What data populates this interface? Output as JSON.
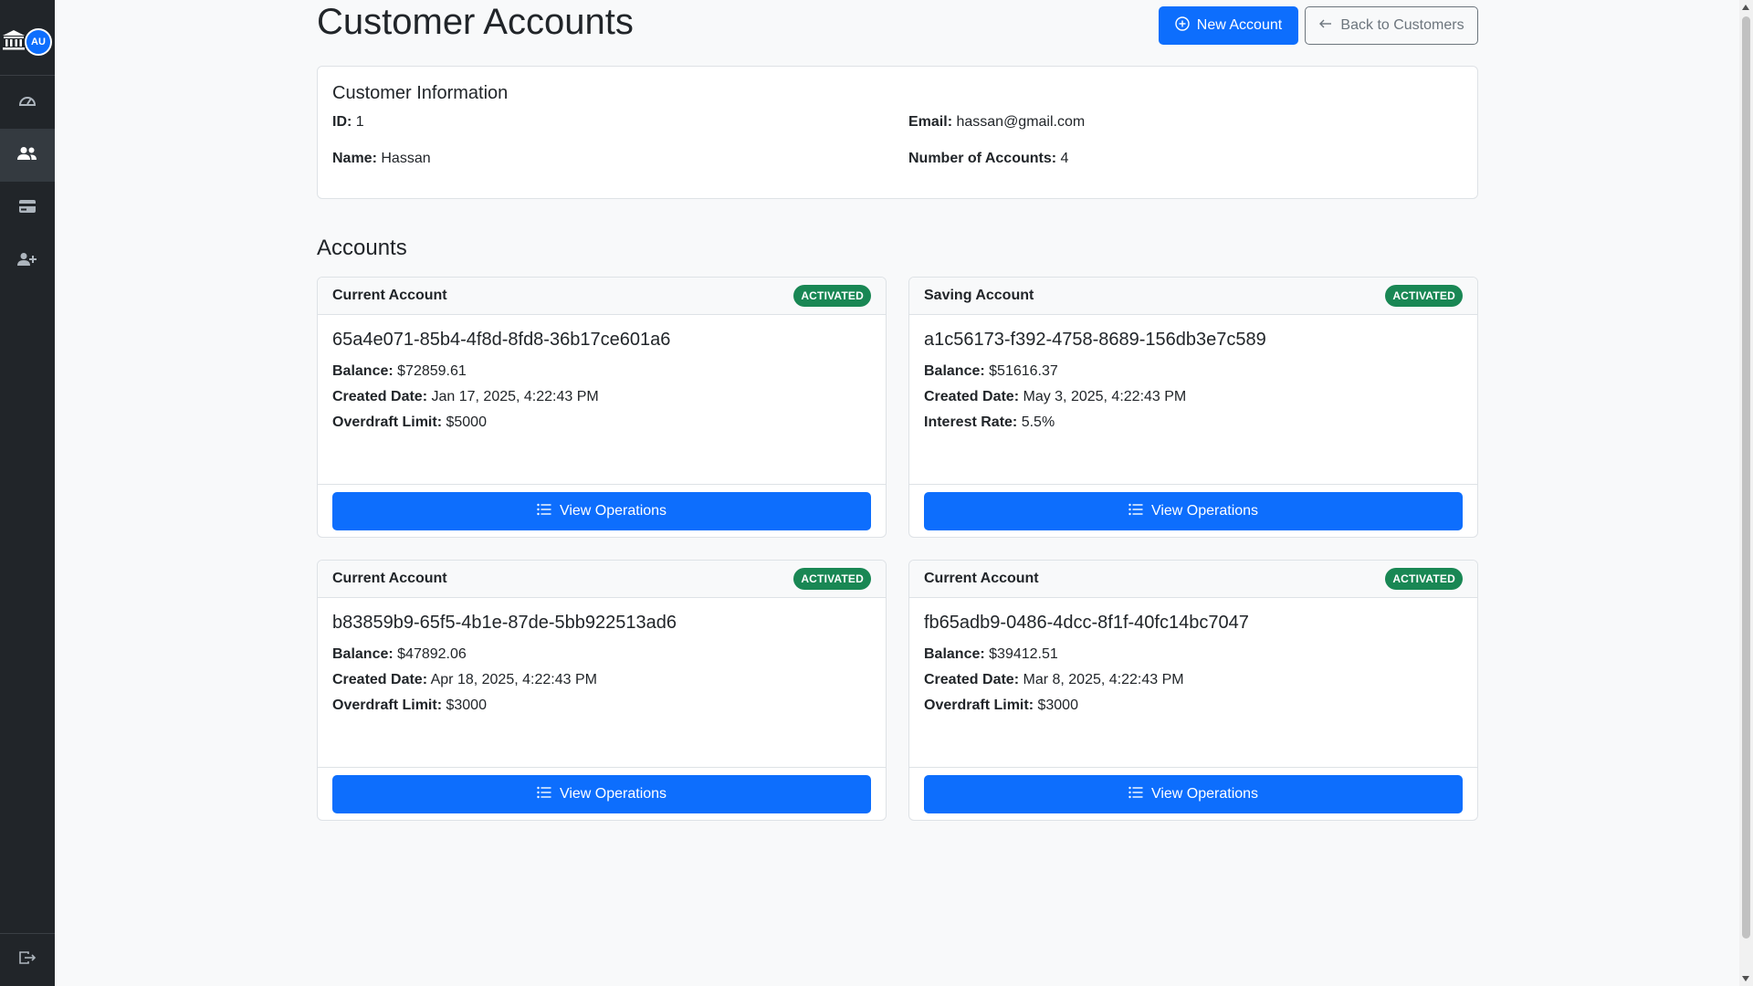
{
  "sidebar": {
    "avatar_initials": "AU",
    "nav_items": [
      {
        "name": "dashboard",
        "icon": "speedometer-icon",
        "active": false
      },
      {
        "name": "customers",
        "icon": "people-icon",
        "active": true
      },
      {
        "name": "accounts",
        "icon": "credit-card-icon",
        "active": false
      },
      {
        "name": "add-customer",
        "icon": "person-plus-icon",
        "active": false
      }
    ],
    "logout_icon": "box-arrow-right-icon"
  },
  "header": {
    "title": "Customer Accounts",
    "new_account_label": "New Account",
    "back_label": "Back to Customers"
  },
  "customer_info": {
    "heading": "Customer Information",
    "id_label": "ID:",
    "id_value": "1",
    "name_label": "Name:",
    "name_value": "Hassan",
    "email_label": "Email:",
    "email_value": "hassan@gmail.com",
    "count_label": "Number of Accounts:",
    "count_value": "4"
  },
  "accounts_heading": "Accounts",
  "accounts": [
    {
      "type": "Current Account",
      "status": "ACTIVATED",
      "id": "65a4e071-85b4-4f8d-8fd8-36b17ce601a6",
      "balance_label": "Balance:",
      "balance": "$72859.61",
      "created_label": "Created Date:",
      "created": "Jan 17, 2025, 4:22:43 PM",
      "extra_label": "Overdraft Limit:",
      "extra": "$5000",
      "button": "View Operations"
    },
    {
      "type": "Saving Account",
      "status": "ACTIVATED",
      "id": "a1c56173-f392-4758-8689-156db3e7c589",
      "balance_label": "Balance:",
      "balance": "$51616.37",
      "created_label": "Created Date:",
      "created": "May 3, 2025, 4:22:43 PM",
      "extra_label": "Interest Rate:",
      "extra": "5.5%",
      "button": "View Operations"
    },
    {
      "type": "Current Account",
      "status": "ACTIVATED",
      "id": "b83859b9-65f5-4b1e-87de-5bb922513ad6",
      "balance_label": "Balance:",
      "balance": "$47892.06",
      "created_label": "Created Date:",
      "created": "Apr 18, 2025, 4:22:43 PM",
      "extra_label": "Overdraft Limit:",
      "extra": "$3000",
      "button": "View Operations"
    },
    {
      "type": "Current Account",
      "status": "ACTIVATED",
      "id": "fb65adb9-0486-4dcc-8f1f-40fc14bc7047",
      "balance_label": "Balance:",
      "balance": "$39412.51",
      "created_label": "Created Date:",
      "created": "Mar 8, 2025, 4:22:43 PM",
      "extra_label": "Overdraft Limit:",
      "extra": "$3000",
      "button": "View Operations"
    }
  ],
  "colors": {
    "primary": "#0d6efd",
    "success": "#198754",
    "sidebar": "#212529"
  }
}
